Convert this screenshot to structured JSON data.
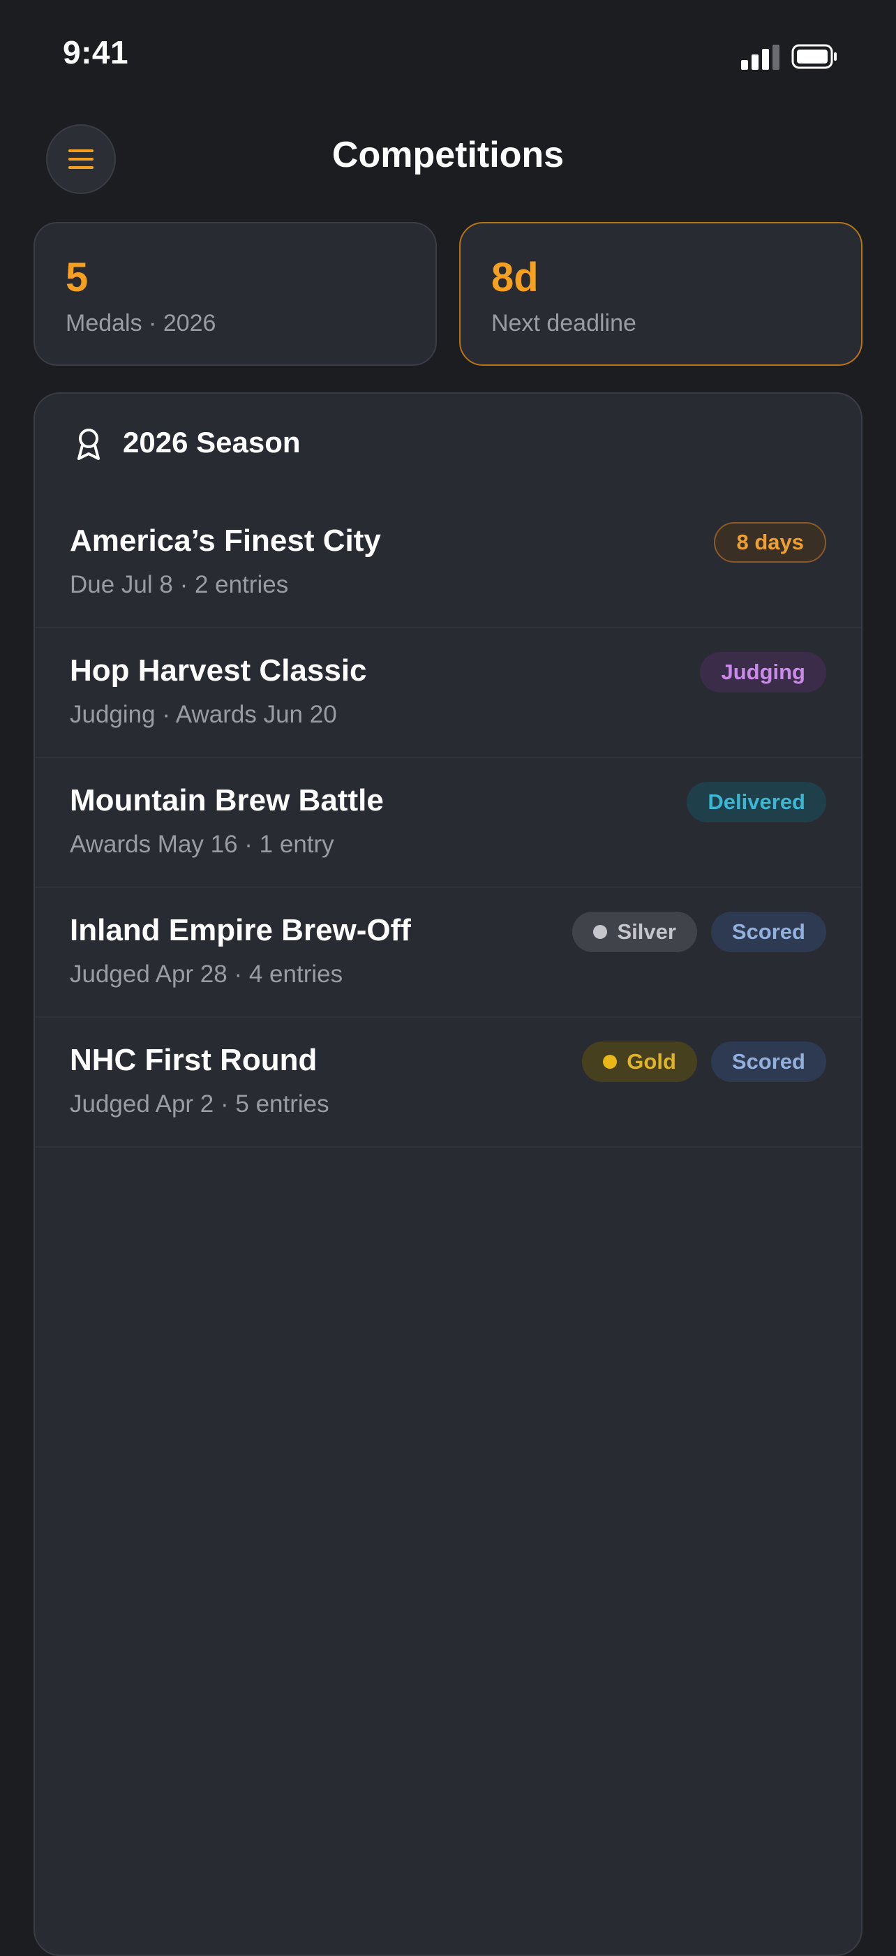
{
  "status_bar": {
    "time": "9:41"
  },
  "header": {
    "title": "Competitions",
    "menu_icon": "hamburger-menu-icon"
  },
  "stats": [
    {
      "value": "5",
      "label": "Medals · 2026"
    },
    {
      "value": "8d",
      "label": "Next deadline"
    }
  ],
  "season": {
    "title": "2026 Season",
    "icon": "award-ribbon-icon",
    "competitions": [
      {
        "name": "America’s Finest City",
        "subtitle": "Due Jul 8 · 2 entries",
        "badges": [
          {
            "label": "8 days"
          }
        ]
      },
      {
        "name": "Hop Harvest Classic",
        "subtitle": "Judging · Awards Jun 20",
        "badges": [
          {
            "label": "Judging"
          }
        ]
      },
      {
        "name": "Mountain Brew Battle",
        "subtitle": "Awards May 16 · 1 entry",
        "badges": [
          {
            "label": "Delivered"
          }
        ]
      },
      {
        "name": "Inland Empire Brew-Off",
        "subtitle": "Judged Apr 28 · 4 entries",
        "badges": [
          {
            "label": "Silver"
          },
          {
            "label": "Scored"
          }
        ]
      },
      {
        "name": "NHC First Round",
        "subtitle": "Judged Apr 2 · 5 entries",
        "badges": [
          {
            "label": "Gold"
          },
          {
            "label": "Scored"
          }
        ]
      }
    ]
  },
  "colors": {
    "background": "#1c1d21",
    "card": "#292b33",
    "accent": "#f5a020",
    "judging": "#c98ae8",
    "delivered": "#3cb6d2",
    "silver": "#c4c6cc",
    "gold": "#e0b42a",
    "scored": "#93b0dc"
  }
}
